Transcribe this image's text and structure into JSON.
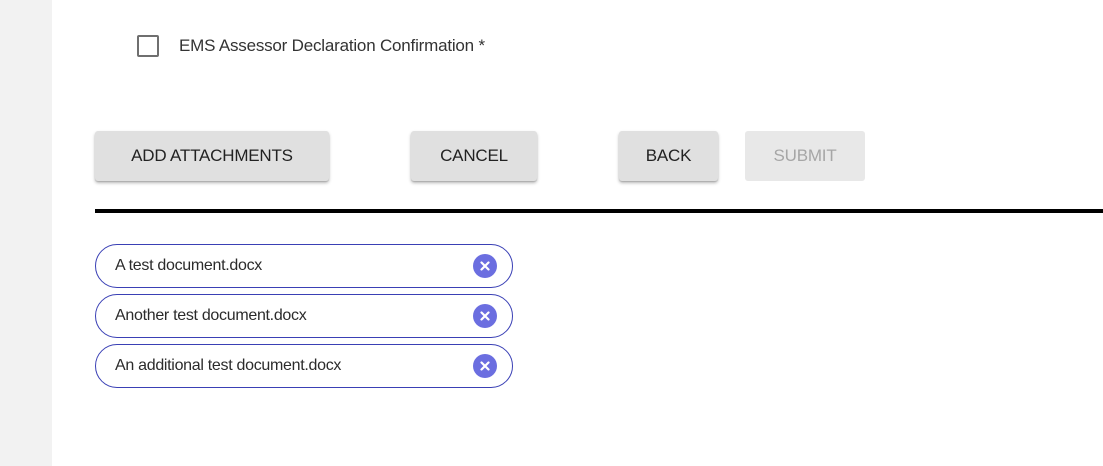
{
  "declaration": {
    "label": "EMS Assessor Declaration Confirmation",
    "required_marker": "*",
    "checked": false
  },
  "actions": {
    "add_attachments": "ADD ATTACHMENTS",
    "cancel": "CANCEL",
    "back": "BACK",
    "submit": "SUBMIT"
  },
  "attachments": [
    {
      "name": "A test document.docx",
      "remove_icon": "close-circle-icon"
    },
    {
      "name": "Another test document.docx",
      "remove_icon": "close-circle-icon"
    },
    {
      "name": "An additional test document.docx",
      "remove_icon": "close-circle-icon"
    }
  ],
  "colors": {
    "chip_border": "#3a40b5",
    "chip_remove": "#6b6ee0",
    "button_bg": "#e0e0e0",
    "button_disabled_text": "#a6a6a6"
  }
}
